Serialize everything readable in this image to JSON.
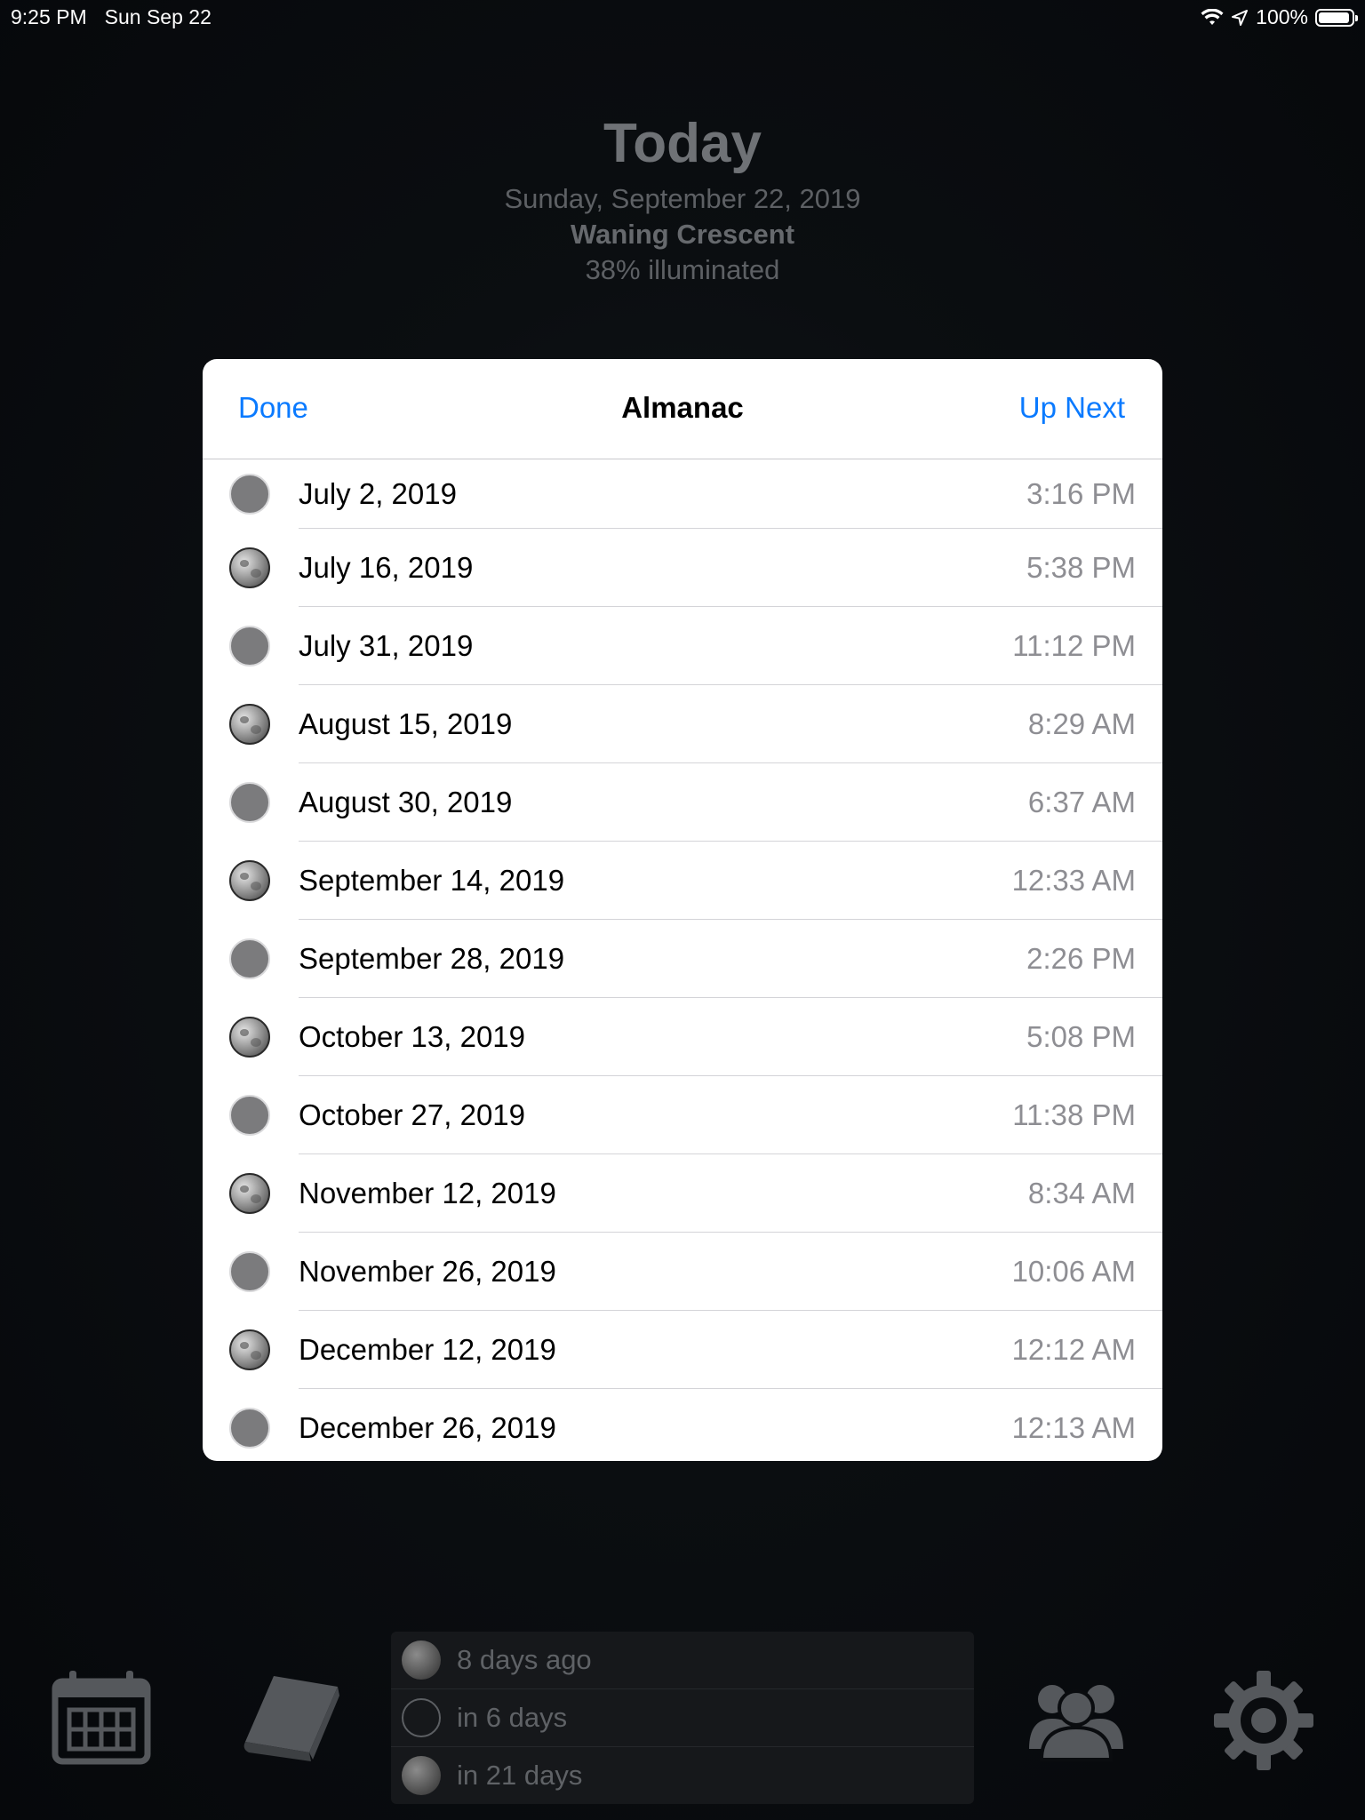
{
  "status_bar": {
    "time": "9:25 PM",
    "date": "Sun Sep 22",
    "battery": "100%"
  },
  "header": {
    "title": "Today",
    "date": "Sunday, September 22, 2019",
    "phase": "Waning Crescent",
    "illumination": "38% illuminated"
  },
  "modal": {
    "done_label": "Done",
    "title": "Almanac",
    "up_next_label": "Up Next",
    "rows": [
      {
        "date": "July 2, 2019",
        "time": "3:16 PM",
        "phase_icon": "new-moon-icon"
      },
      {
        "date": "July 16, 2019",
        "time": "5:38 PM",
        "phase_icon": "full-moon-icon"
      },
      {
        "date": "July 31, 2019",
        "time": "11:12 PM",
        "phase_icon": "new-moon-icon"
      },
      {
        "date": "August 15, 2019",
        "time": "8:29 AM",
        "phase_icon": "full-moon-icon"
      },
      {
        "date": "August 30, 2019",
        "time": "6:37 AM",
        "phase_icon": "new-moon-icon"
      },
      {
        "date": "September 14, 2019",
        "time": "12:33 AM",
        "phase_icon": "full-moon-icon"
      },
      {
        "date": "September 28, 2019",
        "time": "2:26 PM",
        "phase_icon": "new-moon-icon"
      },
      {
        "date": "October 13, 2019",
        "time": "5:08 PM",
        "phase_icon": "full-moon-icon"
      },
      {
        "date": "October 27, 2019",
        "time": "11:38 PM",
        "phase_icon": "new-moon-icon"
      },
      {
        "date": "November 12, 2019",
        "time": "8:34 AM",
        "phase_icon": "full-moon-icon"
      },
      {
        "date": "November 26, 2019",
        "time": "10:06 AM",
        "phase_icon": "new-moon-icon"
      },
      {
        "date": "December 12, 2019",
        "time": "12:12 AM",
        "phase_icon": "full-moon-icon"
      },
      {
        "date": "December 26, 2019",
        "time": "12:13 AM",
        "phase_icon": "new-moon-icon"
      }
    ]
  },
  "upcoming": [
    {
      "label": "8 days ago",
      "phase_icon": "full-moon-icon"
    },
    {
      "label": "in 6 days",
      "phase_icon": "new-moon-icon"
    },
    {
      "label": "in 21 days",
      "phase_icon": "full-moon-icon"
    }
  ],
  "toolbar": {
    "icons": [
      "calendar-icon",
      "book-icon",
      "people-icon",
      "gear-icon"
    ],
    "icon_color": "#55585c"
  },
  "colors": {
    "accent": "#0a7aff",
    "secondary_text": "#8e8e93"
  }
}
